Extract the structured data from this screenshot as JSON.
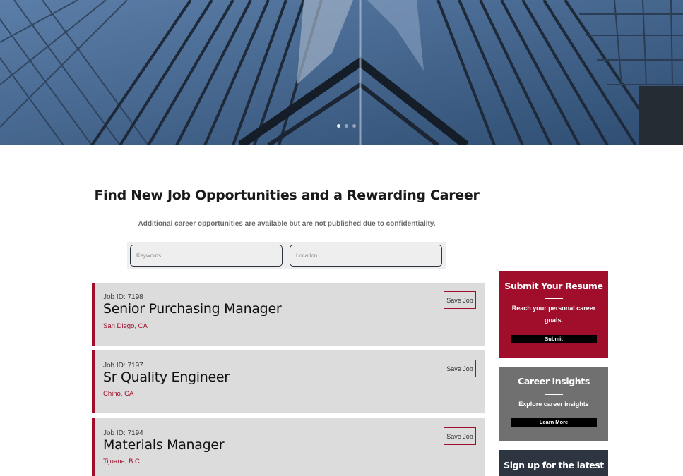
{
  "hero": {
    "image_alt": "glass-skyscraper-facade",
    "slides": [
      {
        "active": true
      },
      {
        "active": false
      },
      {
        "active": false
      }
    ]
  },
  "header": {
    "title": "Find New Job Opportunities and a Rewarding Career",
    "subtitle": "Additional career opportunities are available but are not published due to confidentiality."
  },
  "search": {
    "keywords": {
      "value": "",
      "placeholder": "Keywords"
    },
    "location": {
      "value": "",
      "placeholder": "Location"
    }
  },
  "jobs": [
    {
      "id_label": "Job ID: 7198",
      "title": "Senior Purchasing Manager",
      "location": "San Diego, CA",
      "save_label": "Save Job"
    },
    {
      "id_label": "Job ID: 7197",
      "title": "Sr Quality Engineer",
      "location": "Chino, CA",
      "save_label": "Save Job"
    },
    {
      "id_label": "Job ID: 7194",
      "title": "Materials Manager",
      "location": "Tijuana, B.C.",
      "save_label": "Save Job"
    }
  ],
  "sidebar": {
    "resume": {
      "title": "Submit Your Resume",
      "text": "Reach your personal career goals.",
      "button": "Submit"
    },
    "insights": {
      "title": "Career Insights",
      "text": "Explore career insights",
      "button": "Learn More"
    },
    "signup": {
      "title": "Sign up for the latest"
    }
  },
  "colors": {
    "accent": "#a10e2c",
    "card_gray": "#707070",
    "card_dark": "#2c3540",
    "job_bg": "#dcdcdc"
  }
}
